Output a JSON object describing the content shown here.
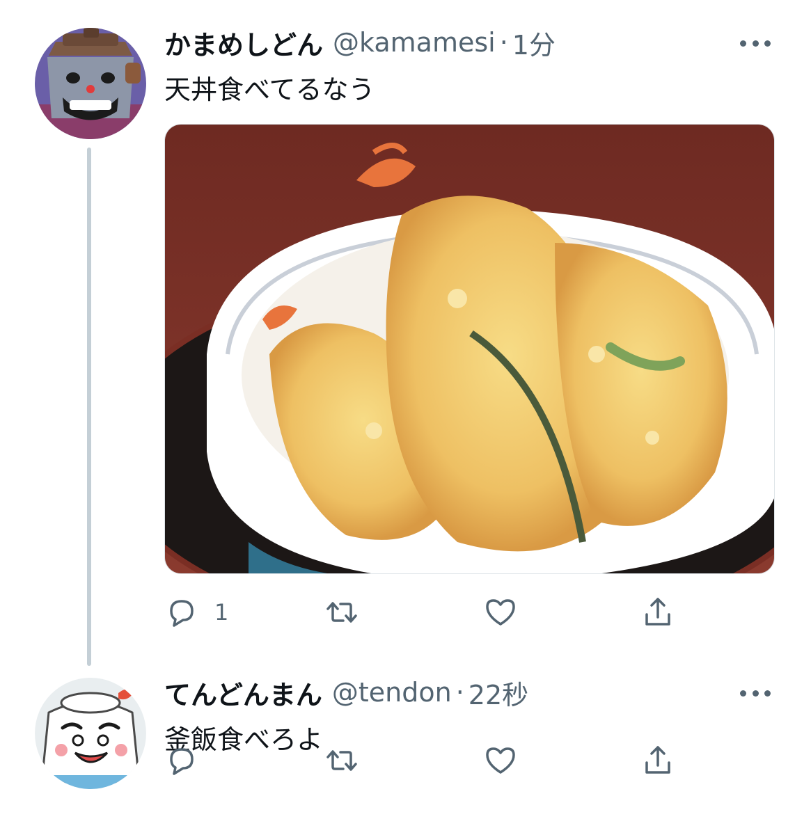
{
  "colors": {
    "text_primary": "#0f1419",
    "text_secondary": "#536471",
    "thread_line": "#c4cfd6"
  },
  "tweets": [
    {
      "display_name": "かまめしどん",
      "handle": "@kamamesi",
      "separator": "·",
      "time": "1分",
      "text": "天丼食べてるなう",
      "avatar_icon": "kamameshidon-avatar",
      "media": "tendon-photo",
      "actions": {
        "reply_icon": "reply-icon",
        "reply_count": "1",
        "retweet_icon": "retweet-icon",
        "like_icon": "heart-icon",
        "share_icon": "share-icon"
      }
    },
    {
      "display_name": "てんどんまん",
      "handle": "@tendon",
      "separator": "·",
      "time": "22秒",
      "text": "釜飯食べろよ",
      "avatar_icon": "tendonman-avatar",
      "actions": {
        "reply_icon": "reply-icon",
        "reply_count": "",
        "retweet_icon": "retweet-icon",
        "like_icon": "heart-icon",
        "share_icon": "share-icon"
      }
    }
  ]
}
